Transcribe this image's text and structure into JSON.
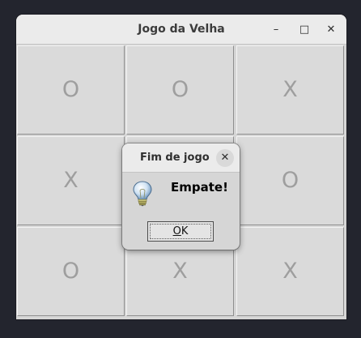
{
  "window": {
    "title": "Jogo da Velha",
    "controls": {
      "minimize": "–",
      "maximize": "□",
      "close": "✕"
    }
  },
  "board": {
    "cells": [
      "O",
      "O",
      "X",
      "X",
      "",
      "O",
      "O",
      "X",
      "X"
    ]
  },
  "dialog": {
    "title": "Fim de jogo",
    "close_glyph": "✕",
    "icon": "lightbulb-icon",
    "message": "Empate!",
    "ok_mnemonic": "O",
    "ok_rest": "K"
  }
}
